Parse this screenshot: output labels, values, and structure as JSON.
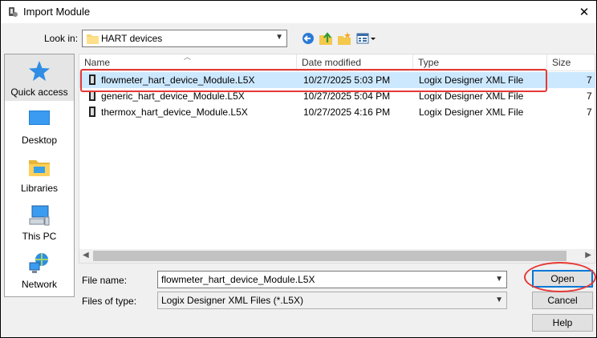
{
  "window": {
    "title": "Import Module",
    "close_glyph": "✕"
  },
  "lookin": {
    "label": "Look in:",
    "value": "HART devices"
  },
  "toolbar": {
    "icons": [
      "back-icon",
      "up-folder-icon",
      "new-folder-icon",
      "view-menu-icon"
    ]
  },
  "places": [
    {
      "label": "Quick access",
      "icon": "star-icon"
    },
    {
      "label": "Desktop",
      "icon": "desktop-icon"
    },
    {
      "label": "Libraries",
      "icon": "libraries-icon"
    },
    {
      "label": "This PC",
      "icon": "pc-icon"
    },
    {
      "label": "Network",
      "icon": "network-icon"
    }
  ],
  "columns": {
    "name": "Name",
    "date": "Date modified",
    "type": "Type",
    "size": "Size"
  },
  "files": [
    {
      "name": "flowmeter_hart_device_Module.L5X",
      "date": "10/27/2025 5:03 PM",
      "type": "Logix Designer XML File",
      "size": "7",
      "selected": true
    },
    {
      "name": "generic_hart_device_Module.L5X",
      "date": "10/27/2025 5:04 PM",
      "type": "Logix Designer XML File",
      "size": "7",
      "selected": false
    },
    {
      "name": "thermox_hart_device_Module.L5X",
      "date": "10/27/2025 4:16 PM",
      "type": "Logix Designer XML File",
      "size": "7",
      "selected": false
    }
  ],
  "filename": {
    "label": "File name:",
    "value": "flowmeter_hart_device_Module.L5X"
  },
  "filetype": {
    "label": "Files of type:",
    "value": "Logix Designer XML Files (*.L5X)"
  },
  "buttons": {
    "open": "Open",
    "cancel": "Cancel",
    "help": "Help"
  },
  "colors": {
    "selection": "#cce8ff",
    "annotation": "#e53935",
    "accent": "#0078d7"
  }
}
